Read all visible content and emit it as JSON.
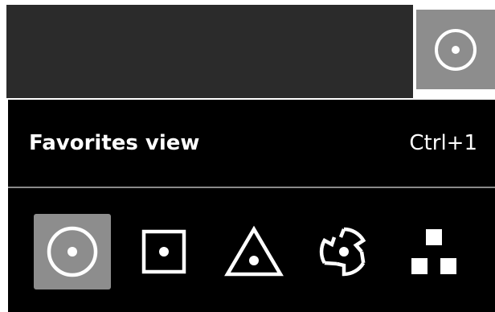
{
  "header": {
    "snap_toggle_icon": "circle-center-icon"
  },
  "favorites_popup": {
    "title": "Favorites view",
    "shortcut": "Ctrl+1",
    "active_index": 0,
    "items": [
      {
        "icon": "circle-center-icon",
        "active": true
      },
      {
        "icon": "square-center-icon",
        "active": false
      },
      {
        "icon": "triangle-center-icon",
        "active": false
      },
      {
        "icon": "rotating-blade-icon",
        "active": false
      },
      {
        "icon": "three-squares-icon",
        "active": false
      }
    ]
  },
  "colors": {
    "background": "#000000",
    "topbar": "#2b2b2b",
    "active_button": "#8d8d8d",
    "divider": "#8a8a8a",
    "icon": "#ffffff"
  }
}
